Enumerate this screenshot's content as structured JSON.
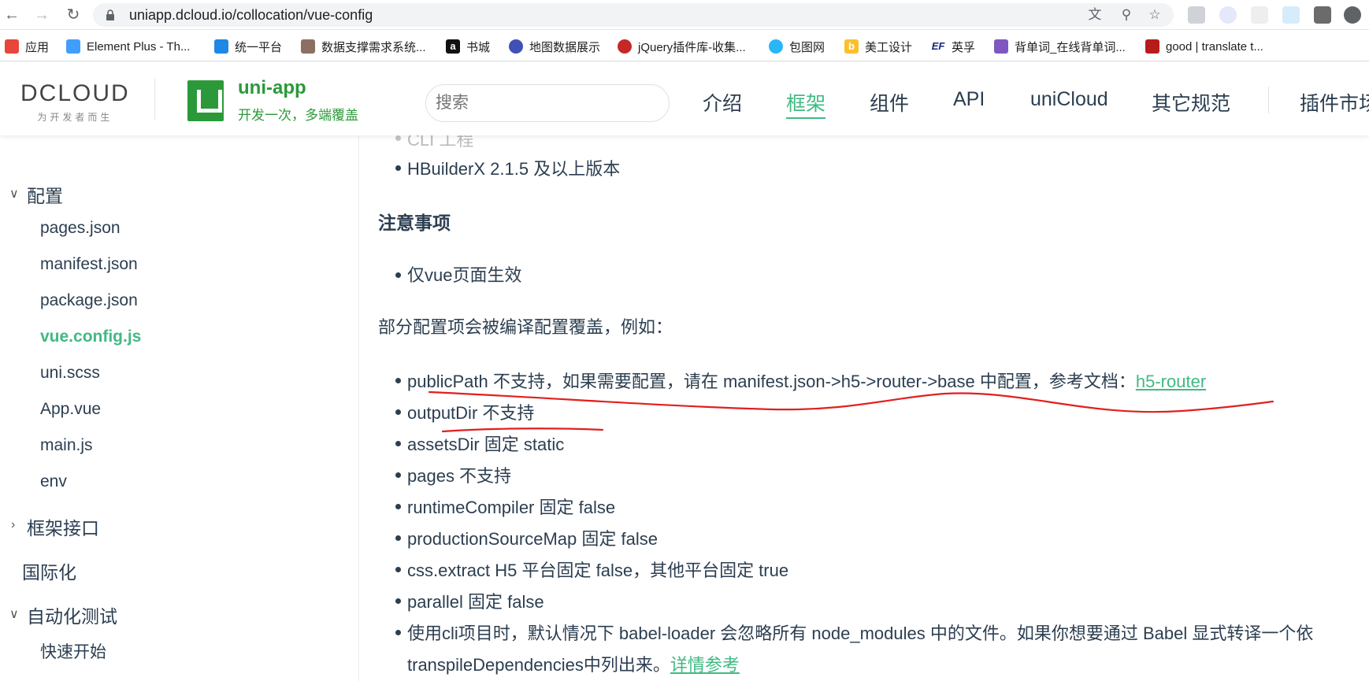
{
  "browser": {
    "url": "uniapp.dcloud.io/collocation/vue-config",
    "bookmarks": [
      {
        "label": "应用",
        "icon": "apps-grid-icon",
        "color": "#e8453c"
      },
      {
        "label": "Element Plus - Th...",
        "icon": "element-plus-icon",
        "color": "#409eff"
      },
      {
        "label": "统一平台",
        "icon": "platform-icon",
        "color": "#1e88e5"
      },
      {
        "label": "数据支撑需求系统...",
        "icon": "data-system-icon",
        "color": "#8d6e63"
      },
      {
        "label": "书城",
        "icon": "amazon-icon",
        "color": "#111111"
      },
      {
        "label": "地图数据展示",
        "icon": "map-data-icon",
        "color": "#3f51b5"
      },
      {
        "label": "jQuery插件库-收集...",
        "icon": "jquery-icon",
        "color": "#c62828"
      },
      {
        "label": "包图网",
        "icon": "baotu-icon",
        "color": "#29b6f6"
      },
      {
        "label": "美工设计",
        "icon": "design-icon",
        "color": "#fbc02d"
      },
      {
        "label": "英孚",
        "icon": "ef-icon",
        "color": "#1a237e"
      },
      {
        "label": "背单词_在线背单词...",
        "icon": "vocab-icon",
        "color": "#7e57c2"
      },
      {
        "label": "good | translate t...",
        "icon": "cambridge-icon",
        "color": "#b71c1c"
      }
    ]
  },
  "header": {
    "dcloud_word": "DCLOUD",
    "dcloud_tagline": "为开发者而生",
    "app_name": "uni-app",
    "app_tagline": "开发一次，多端覆盖",
    "search_placeholder": "搜索",
    "nav": [
      "介绍",
      "框架",
      "组件",
      "API",
      "uniCloud",
      "其它规范",
      "插件市场"
    ],
    "active_nav": "框架"
  },
  "sidebar": {
    "group_config": "配置",
    "config_items": [
      "pages.json",
      "manifest.json",
      "package.json",
      "vue.config.js",
      "uni.scss",
      "App.vue",
      "main.js",
      "env"
    ],
    "active_item": "vue.config.js",
    "group_framework_api": "框架接口",
    "item_i18n": "国际化",
    "group_autotest": "自动化测试",
    "autotest_items": [
      "快速开始"
    ]
  },
  "content": {
    "faded_top": "CLI 工程",
    "hbuilder_item": "HBuilderX 2.1.5 及以上版本",
    "notes_heading": "注意事项",
    "notes_item": "仅vue页面生效",
    "override_intro": "部分配置项会被编译配置覆盖，例如：",
    "public_path_text": "publicPath 不支持，如果需要配置，请在 manifest.json->h5->router->base 中配置，参考文档：",
    "public_path_link": "h5-router",
    "items": [
      "outputDir 不支持",
      "assetsDir 固定 static",
      "pages 不支持",
      "runtimeCompiler 固定 false",
      "productionSourceMap 固定 false",
      "css.extract H5 平台固定 false，其他平台固定 true",
      "parallel 固定 false"
    ],
    "cli_text_line1": "使用cli项目时，默认情况下 babel-loader 会忽略所有 node_modules 中的文件。如果你想要通过 Babel 显式转译一个依",
    "cli_text_line2": "transpileDependencies中列出来。",
    "cli_link": "详情参考"
  },
  "colors": {
    "accent": "#42b983",
    "brand_green": "#2b9939",
    "annotation": "#e0201f"
  }
}
